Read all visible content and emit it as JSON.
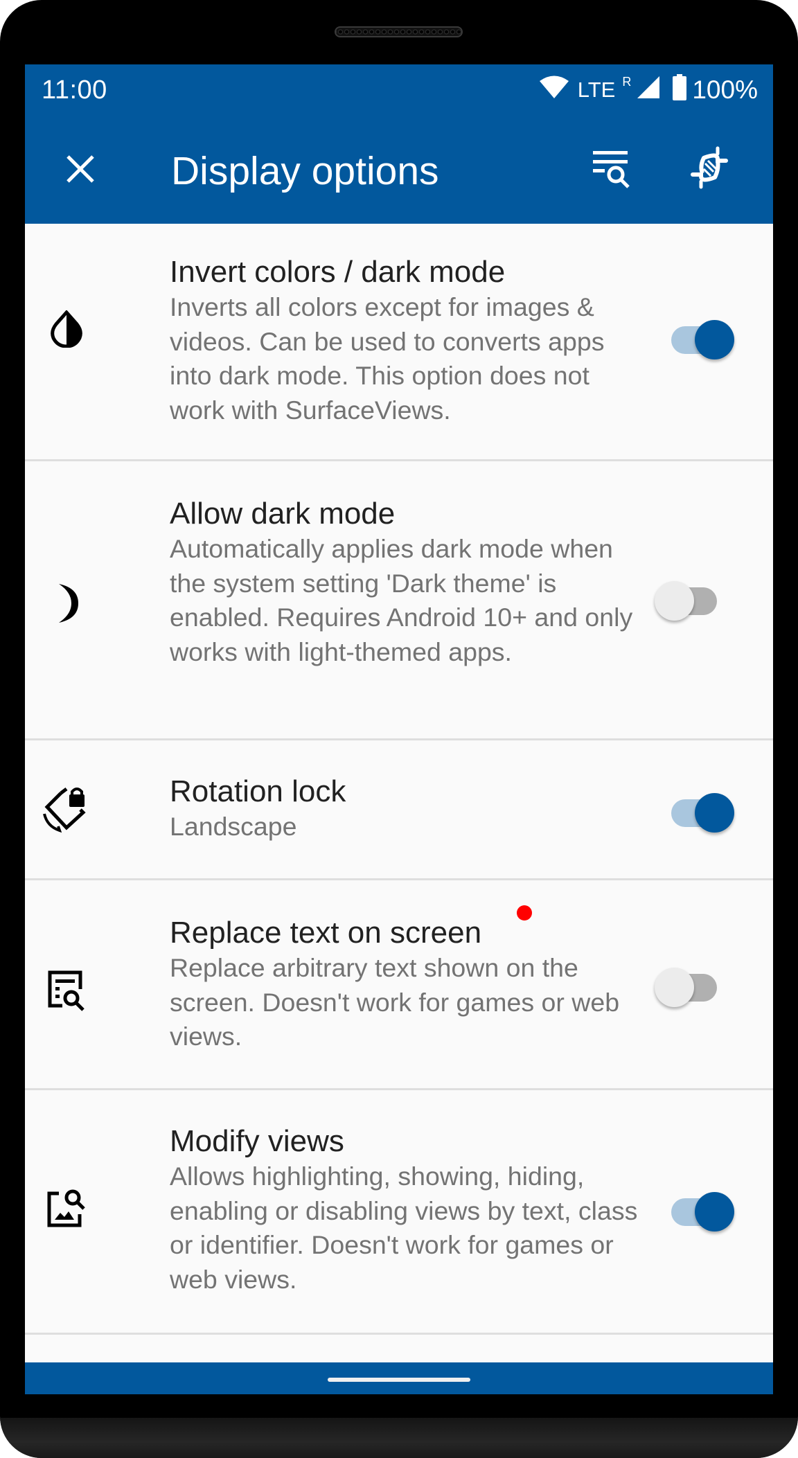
{
  "status_bar": {
    "time": "11:00",
    "network": "LTE",
    "roaming": "R",
    "battery": "100%",
    "icons": [
      "wifi-icon",
      "cell-signal-icon",
      "battery-icon"
    ]
  },
  "app_bar": {
    "title": "Display options",
    "close_icon": "close-icon",
    "actions": [
      "filter-search-icon",
      "dna-icon"
    ]
  },
  "colors": {
    "primary": "#02589d",
    "switch_on_track": "#a9c6de",
    "switch_off_thumb": "#ececec",
    "switch_off_track": "#b0b0b0",
    "badge": "#ff0000"
  },
  "settings": [
    {
      "icon": "invert-colors-icon",
      "title": "Invert colors / dark mode",
      "summary": "Inverts all colors except for images & videos. Can be used to converts apps into dark mode. This option does not work with SurfaceViews.",
      "enabled": true
    },
    {
      "icon": "dark-mode-moon-icon",
      "title": "Allow dark mode",
      "summary": "Automatically applies dark mode when the system setting 'Dark theme' is enabled. Requires Android 10+ and only works with light-themed apps.",
      "enabled": false
    },
    {
      "icon": "rotation-lock-icon",
      "title": "Rotation lock",
      "summary": "Landscape",
      "enabled": true
    },
    {
      "icon": "find-replace-text-icon",
      "title": "Replace text on screen",
      "summary": "Replace arbitrary text shown on the screen. Doesn't work for games or web views.",
      "enabled": false,
      "new_badge": true
    },
    {
      "icon": "image-search-icon",
      "title": "Modify views",
      "summary": "Allows highlighting, showing, hiding, enabling or disabling views by text, class or identifier. Doesn't work for games or web views.",
      "enabled": true
    }
  ]
}
